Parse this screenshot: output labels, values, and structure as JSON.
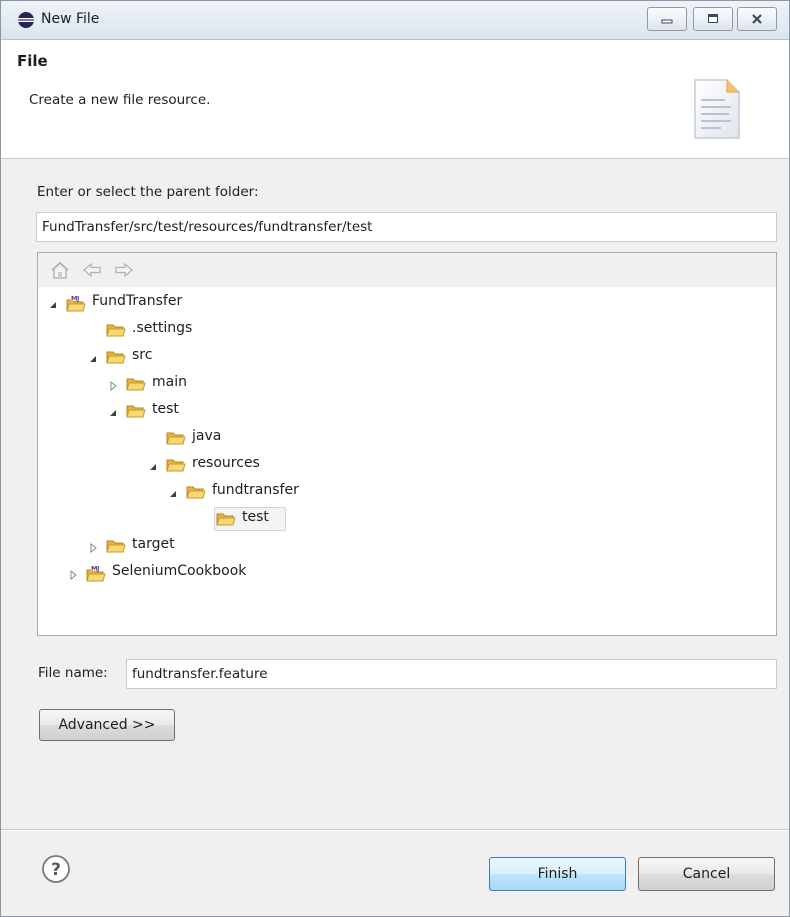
{
  "window": {
    "title": "New File",
    "icons": {
      "app": "eclipse-icon",
      "minimize": "minimize-icon",
      "maximize": "maximize-icon",
      "close": "close-icon"
    }
  },
  "header": {
    "title": "File",
    "description": "Create a new file resource.",
    "banner_icon": "file-document-icon"
  },
  "parent_folder": {
    "prompt": "Enter or select the parent folder:",
    "value": "FundTransfer/src/test/resources/fundtransfer/test"
  },
  "tree": {
    "toolbar_icons": [
      "home-icon",
      "back-arrow-icon",
      "forward-arrow-icon"
    ],
    "nodes": [
      {
        "label": "FundTransfer",
        "icon": "maven-project-icon",
        "twisty": "expanded"
      },
      {
        "label": ".settings",
        "icon": "folder-icon",
        "twisty": "none"
      },
      {
        "label": "src",
        "icon": "folder-icon",
        "twisty": "expanded"
      },
      {
        "label": "main",
        "icon": "folder-icon",
        "twisty": "collapsed"
      },
      {
        "label": "test",
        "icon": "folder-icon",
        "twisty": "expanded"
      },
      {
        "label": "java",
        "icon": "folder-icon",
        "twisty": "none"
      },
      {
        "label": "resources",
        "icon": "folder-icon",
        "twisty": "expanded"
      },
      {
        "label": "fundtransfer",
        "icon": "folder-icon",
        "twisty": "expanded"
      },
      {
        "label": "test",
        "icon": "folder-icon",
        "twisty": "none",
        "selected": true
      },
      {
        "label": "target",
        "icon": "folder-icon",
        "twisty": "collapsed"
      },
      {
        "label": "SeleniumCookbook",
        "icon": "maven-project-icon",
        "twisty": "collapsed"
      }
    ]
  },
  "file_name": {
    "label": "File name:",
    "value": "fundtransfer.feature"
  },
  "buttons": {
    "advanced": "Advanced >>",
    "finish": "Finish",
    "cancel": "Cancel",
    "help_icon": "help-icon"
  },
  "colors": {
    "selection_bg": "#f3f4f6",
    "folder_yellow": "#f3c94a",
    "finish_border": "#3c7fb1"
  }
}
